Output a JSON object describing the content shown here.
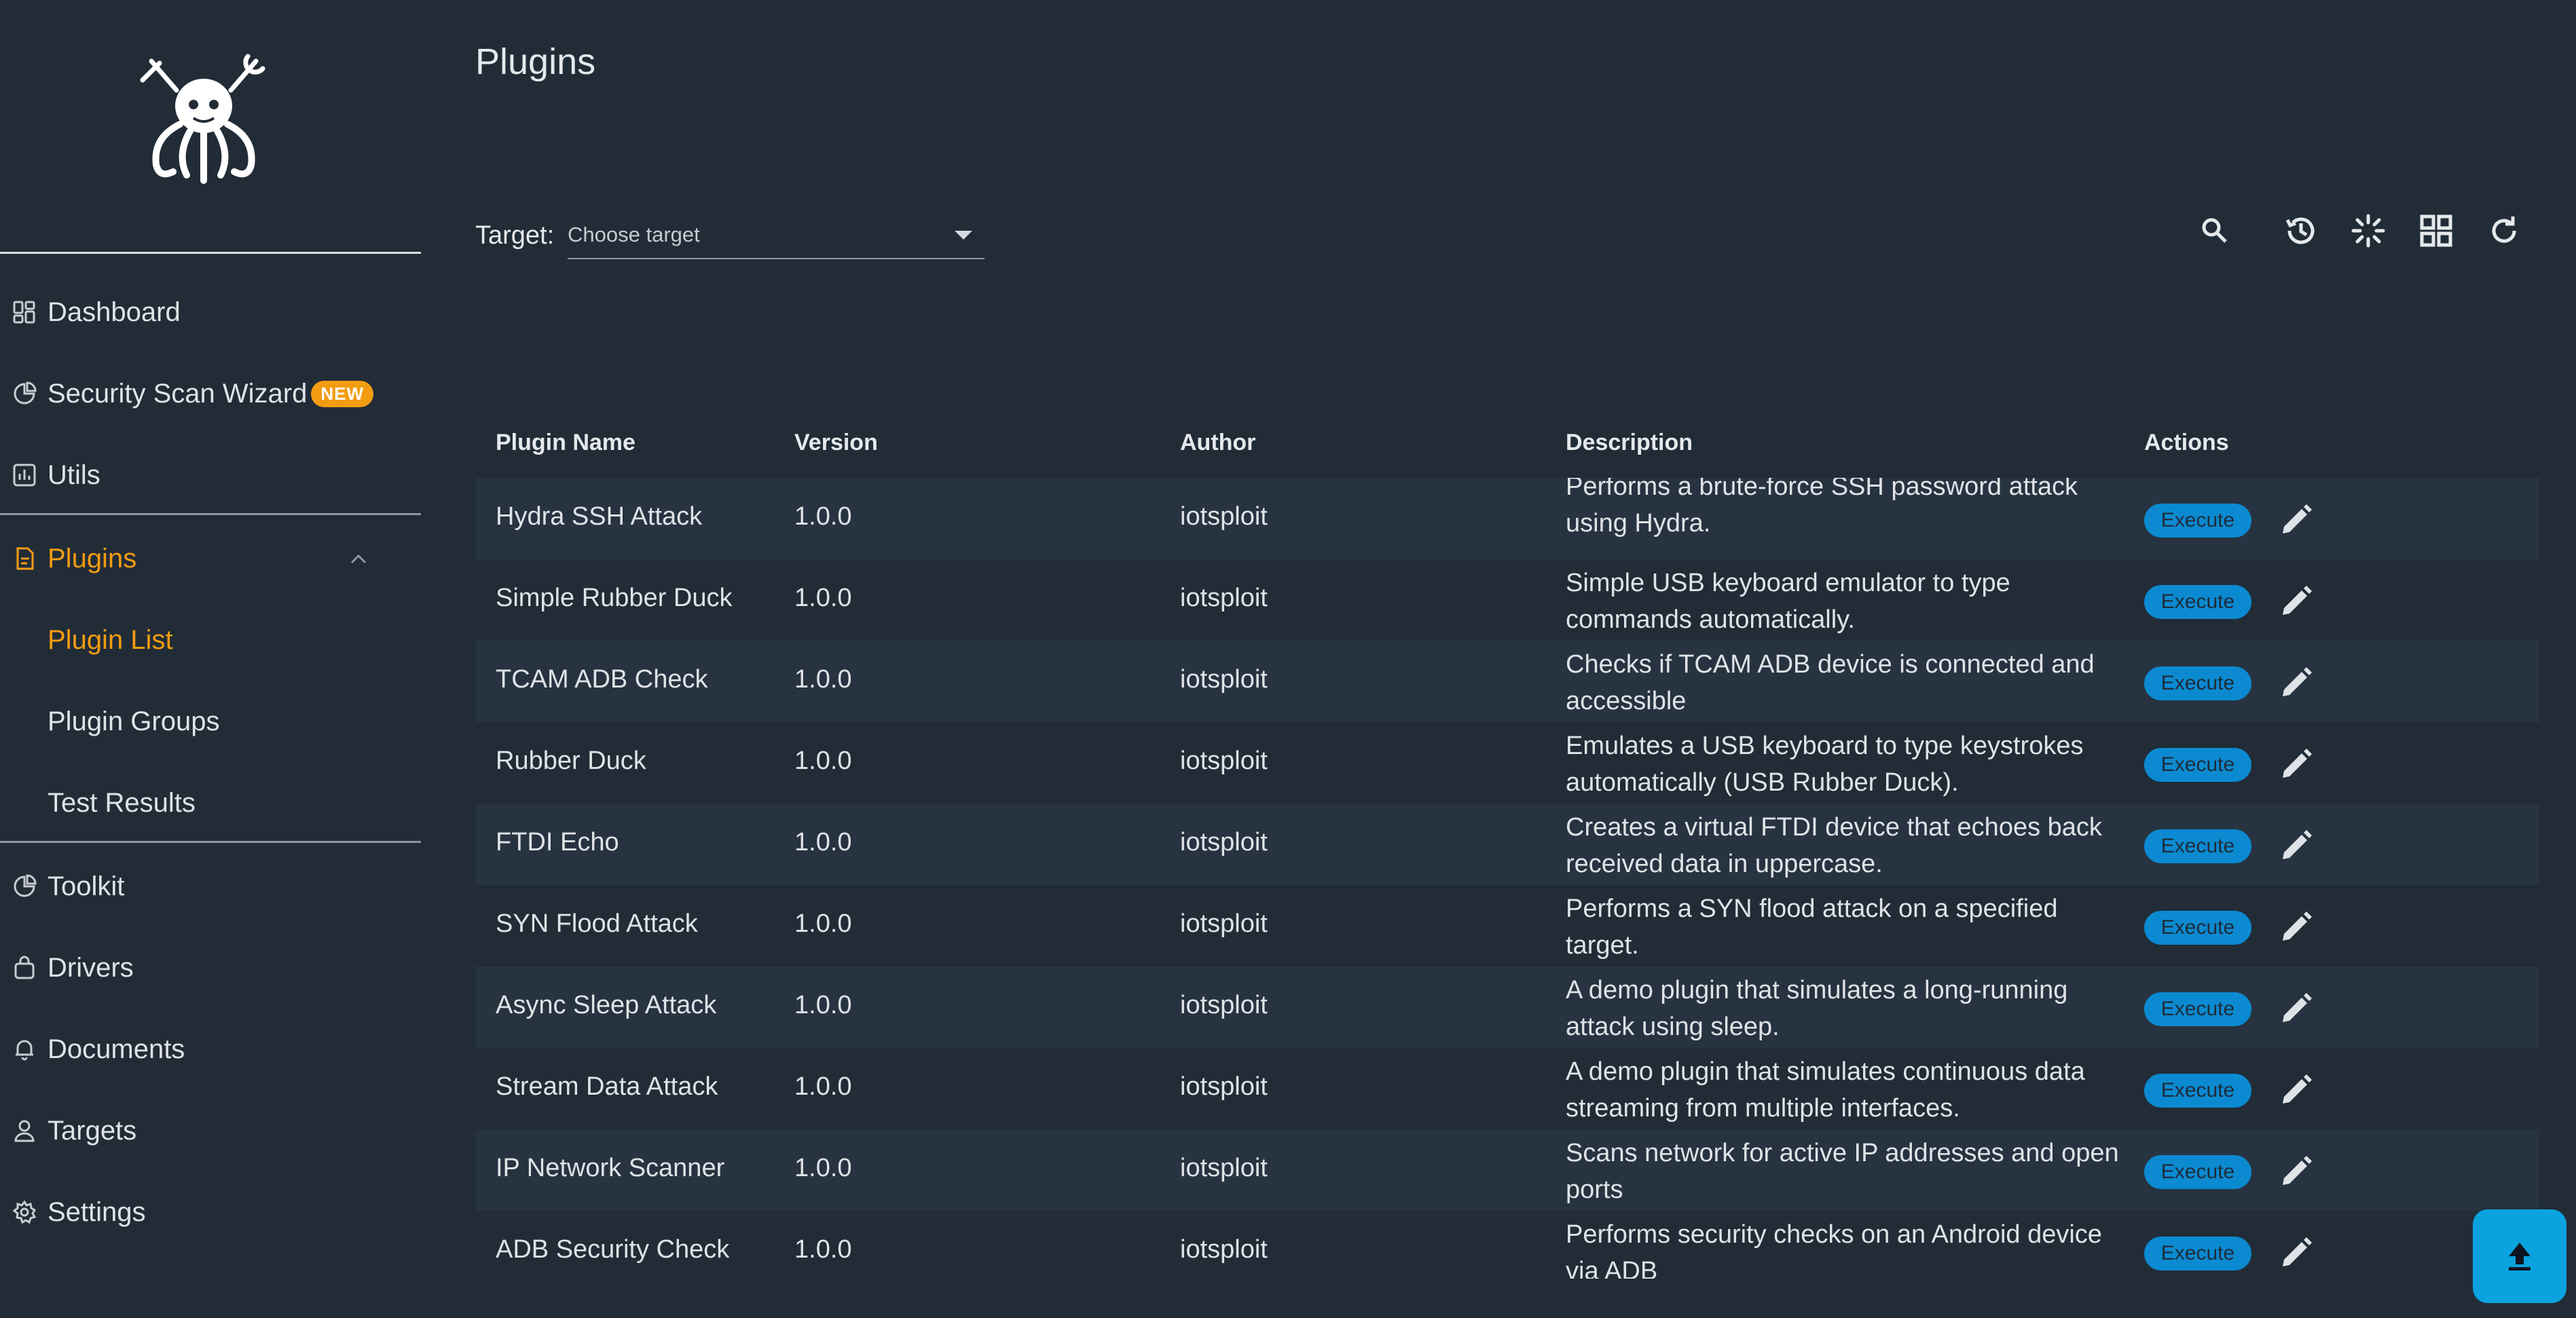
{
  "page": {
    "title": "Plugins"
  },
  "sidebar": {
    "nav": [
      {
        "label": "Dashboard",
        "icon": "dashboard-icon"
      },
      {
        "label": "Security Scan Wizard",
        "icon": "pie-chart-icon",
        "badge": "NEW"
      },
      {
        "label": "Utils",
        "icon": "bar-chart-icon"
      },
      {
        "label": "Plugins",
        "icon": "file-icon"
      },
      {
        "label": "Toolkit",
        "icon": "pie-chart-icon"
      },
      {
        "label": "Drivers",
        "icon": "bag-icon"
      },
      {
        "label": "Documents",
        "icon": "bell-icon"
      },
      {
        "label": "Targets",
        "icon": "user-icon"
      },
      {
        "label": "Settings",
        "icon": "gear-icon"
      }
    ],
    "plugins_sub": [
      {
        "label": "Plugin List"
      },
      {
        "label": "Plugin Groups"
      },
      {
        "label": "Test Results"
      }
    ]
  },
  "filter": {
    "label": "Target:",
    "placeholder": "Choose target"
  },
  "toolbar": {
    "icons": [
      "search-icon",
      "history-icon",
      "loading-icon",
      "grid-icon",
      "refresh-icon"
    ]
  },
  "table": {
    "headers": [
      "Plugin Name",
      "Version",
      "Author",
      "Description",
      "Actions"
    ],
    "execute_label": "Execute",
    "rows": [
      {
        "name": "Hydra SSH Attack",
        "version": "1.0.0",
        "author": "iotsploit",
        "description": "Performs a brute-force SSH password attack using Hydra."
      },
      {
        "name": "Simple Rubber Duck",
        "version": "1.0.0",
        "author": "iotsploit",
        "description": "Simple USB keyboard emulator to type commands automatically."
      },
      {
        "name": "TCAM ADB Check",
        "version": "1.0.0",
        "author": "iotsploit",
        "description": "Checks if TCAM ADB device is connected and accessible"
      },
      {
        "name": "Rubber Duck",
        "version": "1.0.0",
        "author": "iotsploit",
        "description": "Emulates a USB keyboard to type keystrokes automatically (USB Rubber Duck)."
      },
      {
        "name": "FTDI Echo",
        "version": "1.0.0",
        "author": "iotsploit",
        "description": "Creates a virtual FTDI device that echoes back received data in uppercase."
      },
      {
        "name": "SYN Flood Attack",
        "version": "1.0.0",
        "author": "iotsploit",
        "description": "Performs a SYN flood attack on a specified target."
      },
      {
        "name": "Async Sleep Attack",
        "version": "1.0.0",
        "author": "iotsploit",
        "description": "A demo plugin that simulates a long-running attack using sleep."
      },
      {
        "name": "Stream Data Attack",
        "version": "1.0.0",
        "author": "iotsploit",
        "description": "A demo plugin that simulates continuous data streaming from multiple interfaces."
      },
      {
        "name": "IP Network Scanner",
        "version": "1.0.0",
        "author": "iotsploit",
        "description": "Scans network for active IP addresses and open ports"
      },
      {
        "name": "ADB Security Check",
        "version": "1.0.0",
        "author": "iotsploit",
        "description": "Performs security checks on an Android device via ADB"
      }
    ]
  },
  "colors": {
    "accent": "#f39c12",
    "primary": "#0b8ad1",
    "background": "#212c37",
    "row_alt": "#273340"
  }
}
